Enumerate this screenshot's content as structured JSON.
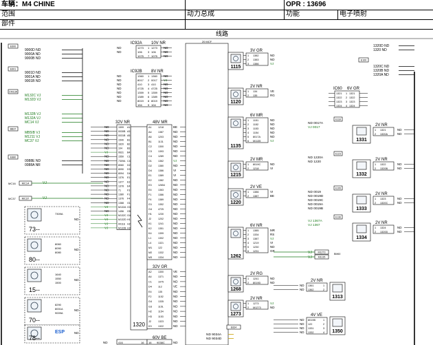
{
  "header": {
    "vehicle_label": "车辆：M4 CHINE",
    "opr_label": "OPR : 13696",
    "scope_label": "范围",
    "group_value": "动力总成",
    "function_label": "功能",
    "function_value": "电子喷射",
    "parts_label": "部件"
  },
  "diagram": {
    "title": "线路",
    "center_top_tag": "20 MCF",
    "left_terminals": [
      {
        "ref": "E600",
        "codes": [
          "9000D ND",
          "9000A ND",
          "9000B ND"
        ]
      },
      {
        "ref": "E601",
        "codes": [
          "9001D ND",
          "9001A ND",
          "9001B ND"
        ]
      },
      {
        "ref": "CM13A",
        "codes": [
          "M132C VJ",
          "M132D VJ"
        ]
      },
      {
        "ref": "",
        "codes": [
          "M132B VJ",
          "M132A VJ",
          "MC14 VJ"
        ]
      },
      {
        "ref": "BB37",
        "codes": [
          "MB5IB VJ",
          "M1211 VJ",
          "MC37 VJ"
        ]
      },
      {
        "ref": "E880",
        "codes": [
          "0088E ND",
          "0088A NR"
        ]
      }
    ],
    "mc_links": [
      {
        "ref": "MC16",
        "label": "MC14",
        "color": "VJ"
      },
      {
        "ref": "MC37",
        "label": "MC37",
        "color": "VJ"
      }
    ],
    "left_icon_blocks": [
      {
        "num": "73--",
        "codes": [
          "7309A"
        ]
      },
      {
        "num": "80--",
        "codes": [
          "8060",
          "8090",
          "8080"
        ]
      },
      {
        "num": "15--",
        "codes": [
          "1640",
          "1550",
          "1500"
        ]
      },
      {
        "num": "70--",
        "codes": [
          "8290",
          "8001A",
          "9009A"
        ]
      },
      {
        "num": "78--",
        "codes": [
          "ESP"
        ]
      }
    ],
    "ic_blocks": [
      {
        "id": "IC92A",
        "conn": "10V NR",
        "rows": [
          [
            "ND",
            "1273",
            "1",
            "1273",
            "ND"
          ],
          [
            "ND",
            "106",
            "3",
            "106",
            "ND"
          ],
          [
            "",
            "1075",
            "7",
            "1075",
            "ND"
          ]
        ]
      },
      {
        "id": "IC92B",
        "conn": "8V NR",
        "rows": [
          [
            "ND",
            "1360",
            "1",
            "1360",
            "ND"
          ],
          [
            "ND",
            "8017",
            "2",
            "0017",
            "VJ"
          ],
          [
            "ND",
            "410",
            "3",
            "410",
            "ND"
          ],
          [
            "ND",
            "4725",
            "4",
            "4725",
            "ND"
          ],
          [
            "ND",
            "1359",
            "5",
            "1359",
            "ND"
          ],
          [
            "ND",
            "1389",
            "6",
            "1389",
            "ND"
          ],
          [
            "ND",
            "8019",
            "8",
            "8019",
            "ND"
          ],
          [
            "",
            "194",
            "9",
            "104",
            "ND"
          ]
        ]
      }
    ],
    "ecu": {
      "number": "1320",
      "left_conn": "32V NR",
      "left_pins": [
        [
          "ND",
          "1599",
          "A1"
        ],
        [
          "ND",
          "0030B",
          "A3"
        ],
        [
          "ND",
          "0031B",
          "A5"
        ],
        [
          "ND",
          "1540",
          "B1"
        ],
        [
          "ND",
          "1620",
          "B2"
        ],
        [
          "ND",
          "104",
          "B3"
        ],
        [
          "VJ",
          "0631",
          "B4"
        ],
        [
          "ND",
          "1550",
          "C1"
        ],
        [
          "ND",
          "7309A",
          "C4"
        ],
        [
          "ND",
          "8060",
          "D2"
        ],
        [
          "ND",
          "8090",
          "D3"
        ],
        [
          "ND",
          "8094",
          "D4"
        ],
        [
          "ND",
          "1376",
          "E1"
        ],
        [
          "ND",
          "1377",
          "E3"
        ],
        [
          "ND",
          "1378",
          "E4"
        ],
        [
          "ND",
          "71",
          "F3"
        ],
        [
          "ND",
          "1380",
          "F1"
        ],
        [
          "ND",
          "1376",
          "F4"
        ],
        [
          "ND",
          "1388",
          "G1"
        ],
        [
          "VJ",
          "M132A",
          "G3"
        ],
        [
          "ND",
          "1456",
          "G5"
        ],
        [
          "VJ",
          "M132C",
          "G4"
        ],
        [
          "VJ",
          "M132D",
          "H1"
        ],
        [
          "VJ",
          "0011E",
          "H2"
        ],
        [
          "VJ",
          "M132B",
          "H3"
        ]
      ],
      "right_conn": "48V MR",
      "right_pins": [
        [
          "A1",
          "1218",
          "BE"
        ],
        [
          "A4",
          "1387",
          "ND"
        ],
        [
          "A6",
          "1203",
          "ND"
        ],
        [
          "B1",
          "1131",
          "ND"
        ],
        [
          "C2",
          "1300",
          "ND"
        ],
        [
          "C3",
          "1393",
          "ND"
        ],
        [
          "C4",
          "1289",
          "ND"
        ],
        [
          "D1",
          "1362",
          "VJ"
        ],
        [
          "D2",
          "1380",
          "ND"
        ],
        [
          "D4",
          "1386",
          "VI"
        ],
        [
          "E1",
          "1389",
          "VI"
        ],
        [
          "E2",
          "1382",
          "ND"
        ],
        [
          "E3",
          "12654",
          "ND"
        ],
        [
          "E4",
          "1363",
          "ND"
        ],
        [
          "F1",
          "1386",
          "ND"
        ],
        [
          "F4",
          "1389",
          "ND"
        ],
        [
          "G1",
          "1352",
          "ND"
        ],
        [
          "G4",
          "4725",
          "ND"
        ],
        [
          "H1",
          "1230",
          "ND"
        ],
        [
          "J2",
          "1202",
          "ND"
        ],
        [
          "K1",
          "1241",
          "ND"
        ],
        [
          "K2",
          "1351",
          "ND"
        ],
        [
          "K4",
          "1399",
          "ND"
        ],
        [
          "L1",
          "1302",
          "ND"
        ],
        [
          "L4",
          "1321",
          "ND"
        ],
        [
          "M1",
          "122",
          "ND"
        ],
        [
          "M2",
          "1332",
          "ND"
        ],
        [
          "M3",
          "1334",
          "ND"
        ]
      ],
      "right_conn2": "32V GR",
      "right_pins2": [
        [
          "A2",
          "1300",
          "VE"
        ],
        [
          "A4",
          "1371",
          "ND"
        ],
        [
          "C1",
          "1075",
          "ND"
        ],
        [
          "D4",
          "112",
          "VE"
        ],
        [
          "E4",
          "135",
          "ND"
        ],
        [
          "F2",
          "1152",
          "ND"
        ],
        [
          "G4",
          "1335",
          "ND"
        ],
        [
          "G3",
          "1151",
          "ND"
        ],
        [
          "H2",
          "1154",
          "ND"
        ],
        [
          "H3",
          "1153",
          "ND"
        ],
        [
          "J2",
          "1323",
          "ND"
        ],
        [
          "K3",
          "1322",
          "ND"
        ]
      ],
      "bottom_conn": "60V BE",
      "bottom_left": [
        "ND",
        "416",
        "16"
      ],
      "bottom_right": [
        "16",
        "9038C",
        "ND"
      ]
    },
    "right_column_tags": [
      "20 MCF"
    ],
    "components_mid": [
      {
        "id": "1115",
        "conn": "3V GR",
        "rows": [
          [
            "1",
            "1382",
            "ND"
          ],
          [
            "2",
            "1383",
            "ND"
          ],
          [
            "3",
            "1386",
            "VJ"
          ]
        ]
      },
      {
        "id": "1120",
        "conn": "2V NR",
        "rows": [
          [
            "1",
            "134",
            "VE"
          ],
          [
            "2",
            "135",
            "RG"
          ]
        ]
      },
      {
        "id": "1135",
        "conn": "6V MR",
        "rows": [
          [
            "1",
            "1151",
            "ND"
          ],
          [
            "2",
            "1152",
            "ND"
          ],
          [
            "3",
            "1153",
            "ND"
          ],
          [
            "4",
            "1154",
            "ND"
          ],
          [
            "5",
            "8017A",
            "ND"
          ],
          [
            "6",
            "M1135",
            "VJ"
          ]
        ]
      },
      {
        "id": "1215",
        "conn": "2V MR",
        "rows": [
          [
            "1",
            "8019C",
            "ND"
          ],
          [
            "2",
            "1218",
            "VI"
          ]
        ]
      },
      {
        "id": "1220",
        "conn": "2V VE",
        "rows": [
          [
            "1",
            "1386",
            "VI"
          ],
          [
            "2",
            "1387",
            "BE"
          ]
        ]
      },
      {
        "id": "1262",
        "conn": "6V NR",
        "rows": [
          [
            "1",
            "1385",
            "MR"
          ],
          [
            "2",
            "1334",
            "RS"
          ],
          [
            "3",
            "1387",
            "VJ"
          ],
          [
            "4",
            "1219",
            "VI"
          ],
          [
            "5",
            "1230",
            "ND"
          ],
          [
            "6",
            "1231",
            "GR"
          ]
        ]
      },
      {
        "id": "1268",
        "conn": "2V RG",
        "rows": [
          [
            "1",
            "1241",
            "ND"
          ],
          [
            "2",
            "8019D",
            "ND"
          ]
        ]
      },
      {
        "id": "1273",
        "conn": "2V NR",
        "rows": [
          [
            "1",
            "1273",
            "VJ"
          ],
          [
            "2",
            "M1273",
            "ND"
          ]
        ]
      }
    ],
    "right_top": {
      "ref": "E100",
      "codes": [
        "1320D ND",
        "1320 ND",
        "1320C ND",
        "1320B ND",
        "1320A ND"
      ]
    },
    "ic60": {
      "id": "IC60",
      "conn": "6V GR",
      "rows": [
        [
          "1321",
          "1",
          "1321"
        ],
        [
          "1322",
          "2",
          "1322"
        ],
        [
          "1323",
          "3",
          "1323"
        ],
        [
          "1324",
          "4",
          "1324"
        ]
      ]
    },
    "components_right": [
      {
        "id": "1331",
        "conn": "2V NR",
        "rows": [
          [
            "1",
            "1321",
            "ND"
          ],
          [
            "2",
            "1320A",
            "ND"
          ]
        ],
        "ref": "E118",
        "inputs": [
          "ND 0017A",
          "VJ 0017"
        ]
      },
      {
        "id": "1332",
        "conn": "2V NR",
        "rows": [
          [
            "1",
            "1322",
            "ND"
          ],
          [
            "2",
            "1320B",
            "ND"
          ]
        ],
        "ref": "E123",
        "inputs": [
          "ND 1220A",
          "ND 1220"
        ]
      },
      {
        "id": "1333",
        "conn": "2V NR",
        "rows": [
          [
            "1",
            "1323",
            "ND"
          ],
          [
            "2",
            "1320C",
            "ND"
          ]
        ],
        "ref": "E195",
        "inputs": [
          "ND 0019",
          "ND 0019D",
          "ND 0019C",
          "ND 0019A",
          "ND 0019B"
        ]
      },
      {
        "id": "1334",
        "conn": "2V NR",
        "rows": [
          [
            "1",
            "1324",
            "ND"
          ],
          [
            "2",
            "1320D",
            "ND"
          ]
        ],
        "ref": "E136",
        "inputs": [
          "VJ 1367A",
          "VJ 1367"
        ]
      }
    ],
    "m_links": [
      {
        "color": "VJ",
        "code": "M1273"
      },
      {
        "color": "VJ",
        "code": "M1135"
      }
    ],
    "m_ref": "BM60",
    "components_bottom_right": [
      {
        "id": "1313",
        "conn": "2V NR",
        "rows": [
          [
            "1",
            "1361",
            "ND"
          ],
          [
            "2",
            "1362",
            "ND"
          ]
        ]
      },
      {
        "id": "1350",
        "conn": "4V VE",
        "rows": [
          [
            "1",
            "8019B",
            "ND"
          ],
          [
            "2",
            "122",
            "ND"
          ],
          [
            "3",
            "1331",
            "ND"
          ],
          [
            "4",
            "1332",
            "ND"
          ]
        ]
      }
    ],
    "bottom_links": [
      "ND 9034A",
      "ND 9034D"
    ],
    "bottom_ref": "E834"
  }
}
